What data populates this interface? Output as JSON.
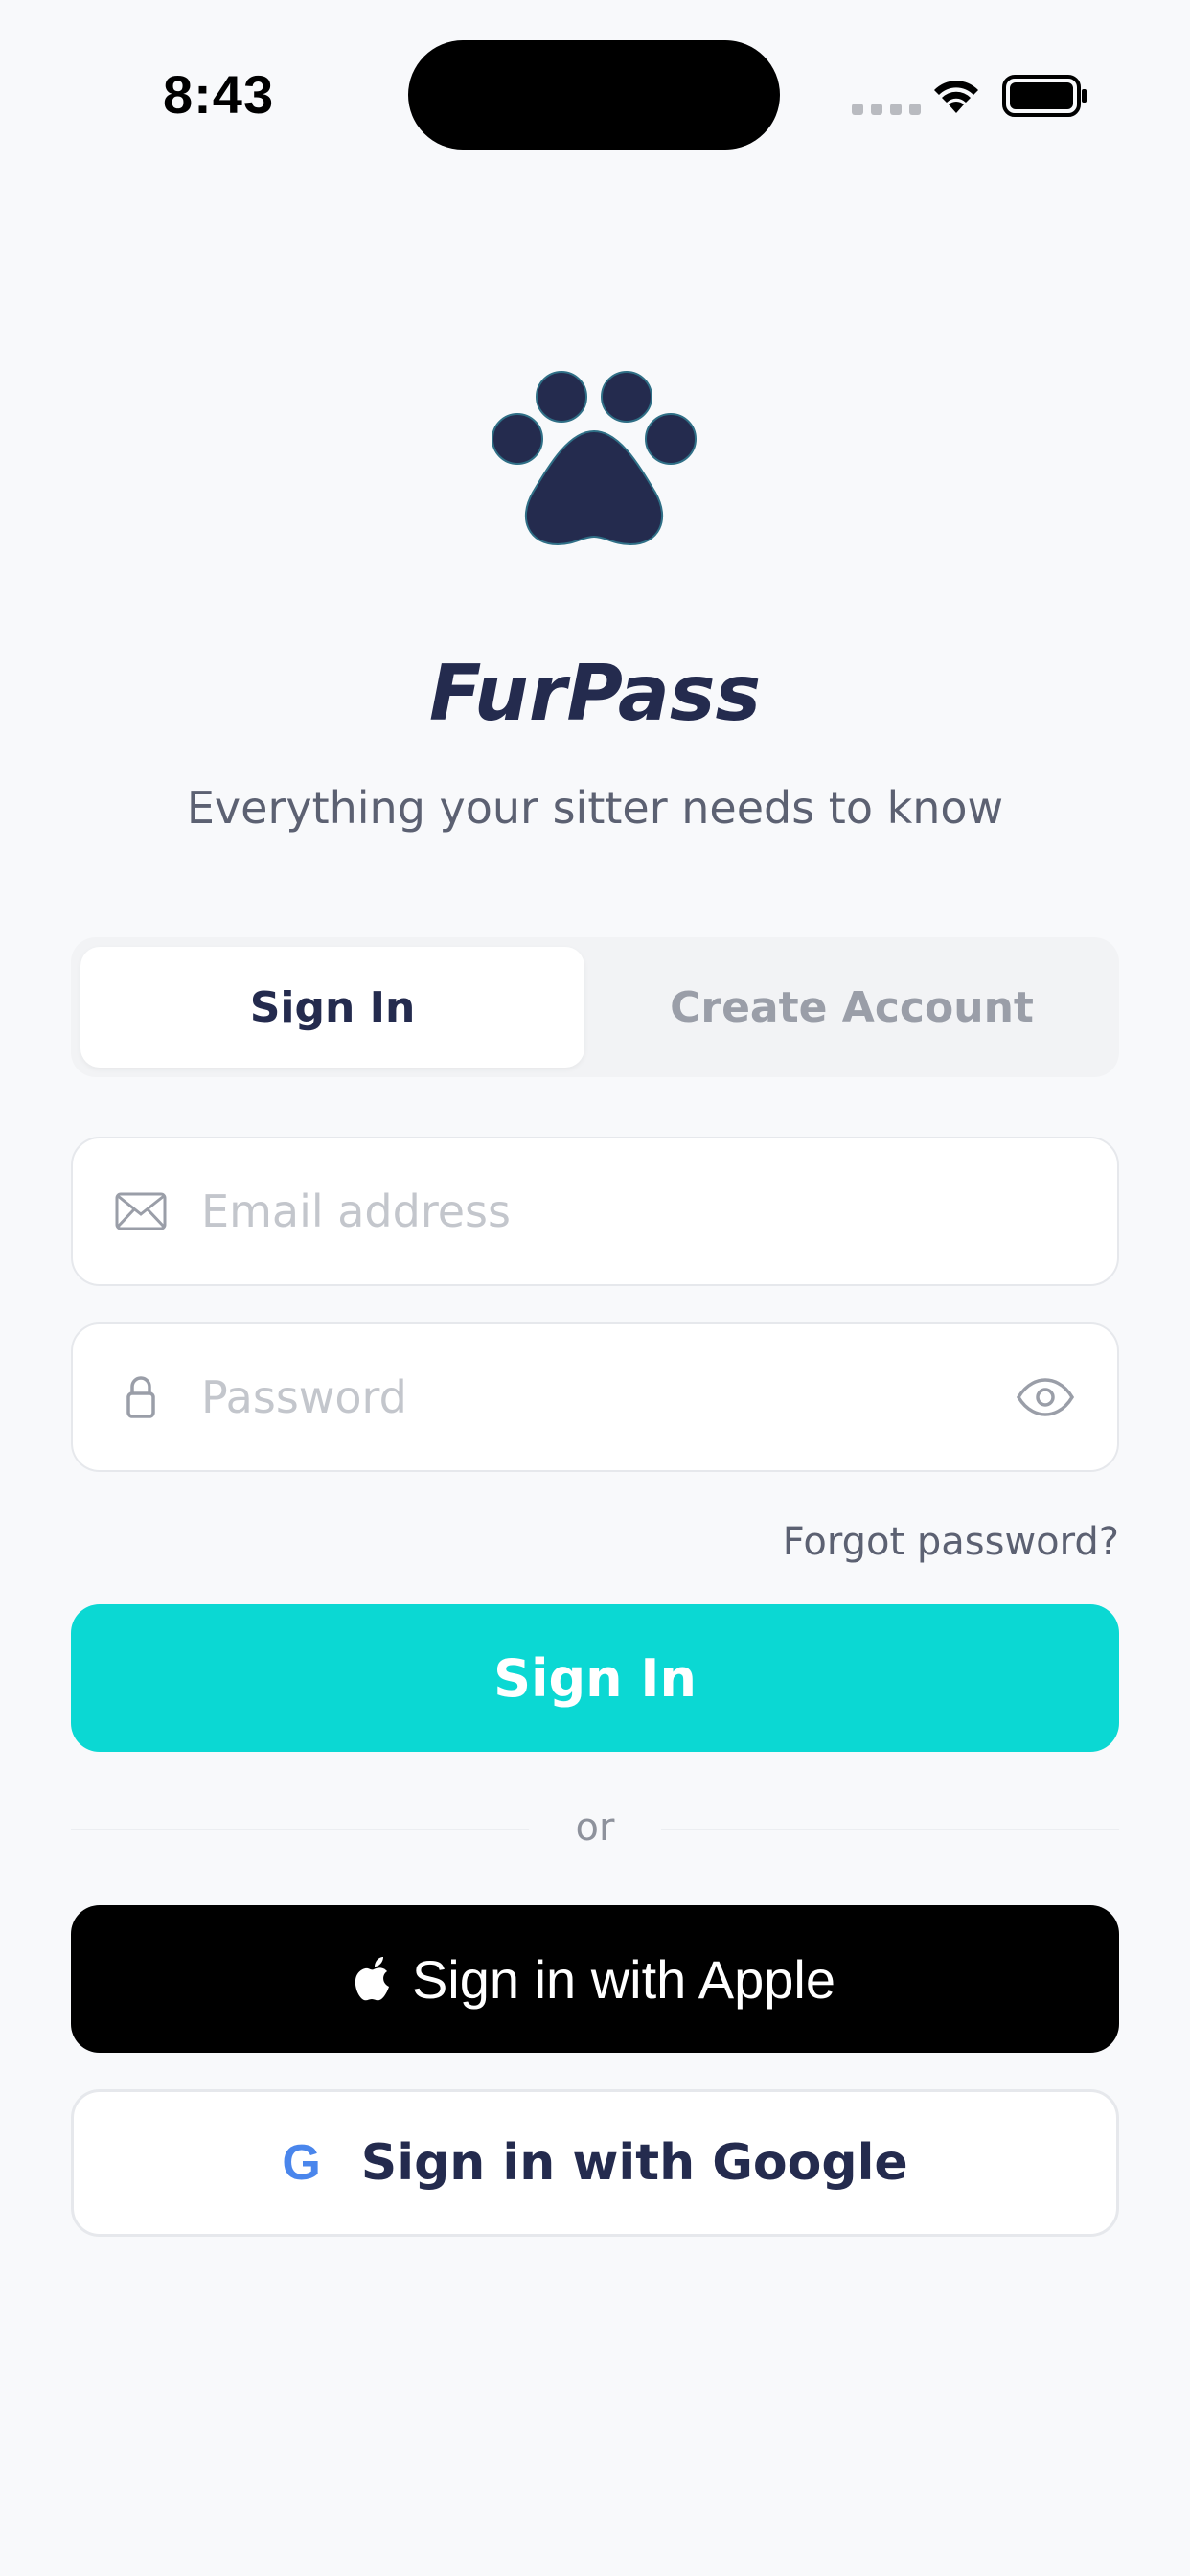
{
  "status_bar": {
    "time": "8:43"
  },
  "brand": {
    "logo_icon": "paw-icon",
    "title": "FurPass",
    "tagline": "Everything your sitter needs to know"
  },
  "auth_tabs": {
    "sign_in": "Sign In",
    "create_account": "Create Account",
    "active": "sign_in"
  },
  "form": {
    "email": {
      "icon": "envelope-icon",
      "placeholder": "Email address",
      "value": ""
    },
    "password": {
      "icon": "lock-icon",
      "placeholder": "Password",
      "value": "",
      "toggle_icon": "eye-icon"
    },
    "forgot_password": "Forgot password?",
    "submit_label": "Sign In"
  },
  "divider": {
    "text": "or"
  },
  "social": {
    "apple_label": "Sign in with Apple",
    "google_label": "Sign in with Google",
    "google_mark": "G"
  },
  "colors": {
    "background": "#f8f9fb",
    "primary": "#0bd8d3",
    "brand_navy": "#242b4e",
    "google_blue": "#4a86ec"
  }
}
